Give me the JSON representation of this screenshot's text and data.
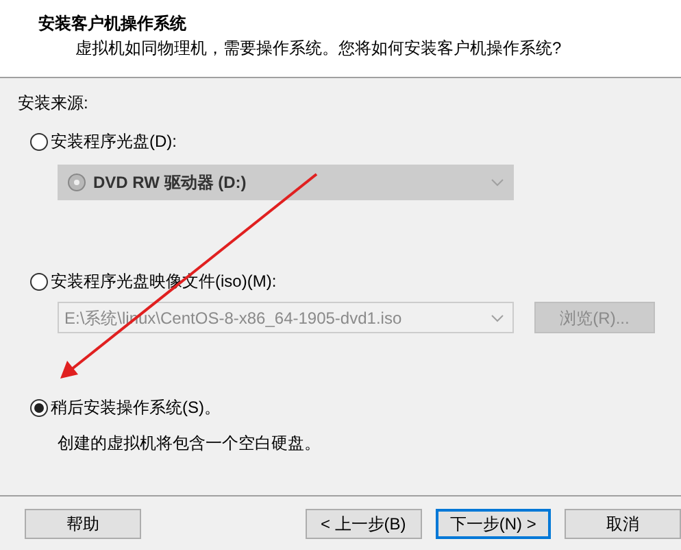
{
  "header": {
    "title": "安装客户机操作系统",
    "subtitle": "虚拟机如同物理机，需要操作系统。您将如何安装客户机操作系统?"
  },
  "source_label": "安装来源:",
  "options": [
    {
      "kind": "drive",
      "label": "安装程序光盘(D):",
      "selected": false,
      "drive": {
        "value": "DVD RW 驱动器 (D:)",
        "disabled": true
      }
    },
    {
      "kind": "iso",
      "label": "安装程序光盘映像文件(iso)(M):",
      "selected": false,
      "iso": {
        "value": "E:\\系统\\linux\\CentOS-8-x86_64-1905-dvd1.iso",
        "disabled": true
      },
      "browse": {
        "label": "浏览(R)...",
        "disabled": true
      }
    },
    {
      "kind": "later",
      "label": "稍后安装操作系统(S)。",
      "selected": true,
      "note": "创建的虚拟机将包含一个空白硬盘。"
    }
  ],
  "buttons": [
    {
      "label": "帮助",
      "focused": false
    },
    {
      "label": "< 上一步(B)",
      "focused": false
    },
    {
      "label": "下一步(N) >",
      "focused": true
    },
    {
      "label": "取消",
      "focused": false
    }
  ]
}
